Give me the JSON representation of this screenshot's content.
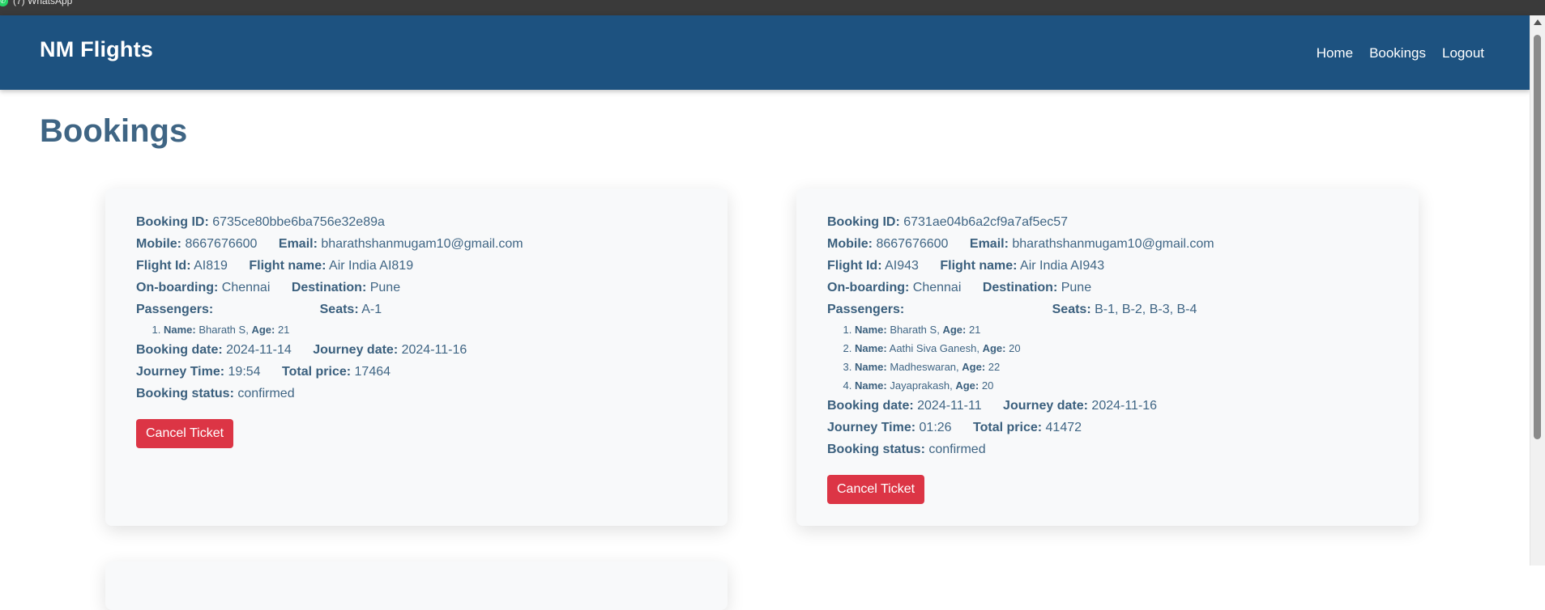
{
  "os": {
    "tab_label": "(7) WhatsApp"
  },
  "navbar": {
    "brand": "NM Flights",
    "links": [
      "Home",
      "Bookings",
      "Logout"
    ]
  },
  "page": {
    "title": "Bookings"
  },
  "labels": {
    "booking_id": "Booking ID:",
    "mobile": "Mobile:",
    "email": "Email:",
    "flight_id": "Flight Id:",
    "flight_name": "Flight name:",
    "onboarding": "On-boarding:",
    "destination": "Destination:",
    "passengers": "Passengers:",
    "seats": "Seats:",
    "name": "Name:",
    "age": "Age:",
    "booking_date": "Booking date:",
    "journey_date": "Journey date:",
    "journey_time": "Journey Time:",
    "total_price": "Total price:",
    "booking_status": "Booking status:",
    "cancel": "Cancel Ticket"
  },
  "bookings": [
    {
      "booking_id": "6735ce80bbe6ba756e32e89a",
      "mobile": "8667676600",
      "email": "bharathshanmugam10@gmail.com",
      "flight_id": "AI819",
      "flight_name": "Air India AI819",
      "onboarding": "Chennai",
      "destination": "Pune",
      "seats": "A-1",
      "passengers": [
        {
          "name": "Bharath S",
          "age": "21"
        }
      ],
      "booking_date": "2024-11-14",
      "journey_date": "2024-11-16",
      "journey_time": "19:54",
      "total_price": "17464",
      "status": "confirmed"
    },
    {
      "booking_id": "6731ae04b6a2cf9a7af5ec57",
      "mobile": "8667676600",
      "email": "bharathshanmugam10@gmail.com",
      "flight_id": "AI943",
      "flight_name": "Air India AI943",
      "onboarding": "Chennai",
      "destination": "Pune",
      "seats": "B-1, B-2, B-3, B-4",
      "passengers": [
        {
          "name": "Bharath S",
          "age": "21"
        },
        {
          "name": "Aathi Siva Ganesh",
          "age": "20"
        },
        {
          "name": "Madheswaran",
          "age": "22"
        },
        {
          "name": "Jayaprakash",
          "age": "20"
        }
      ],
      "booking_date": "2024-11-11",
      "journey_date": "2024-11-16",
      "journey_time": "01:26",
      "total_price": "41472",
      "status": "confirmed"
    }
  ]
}
